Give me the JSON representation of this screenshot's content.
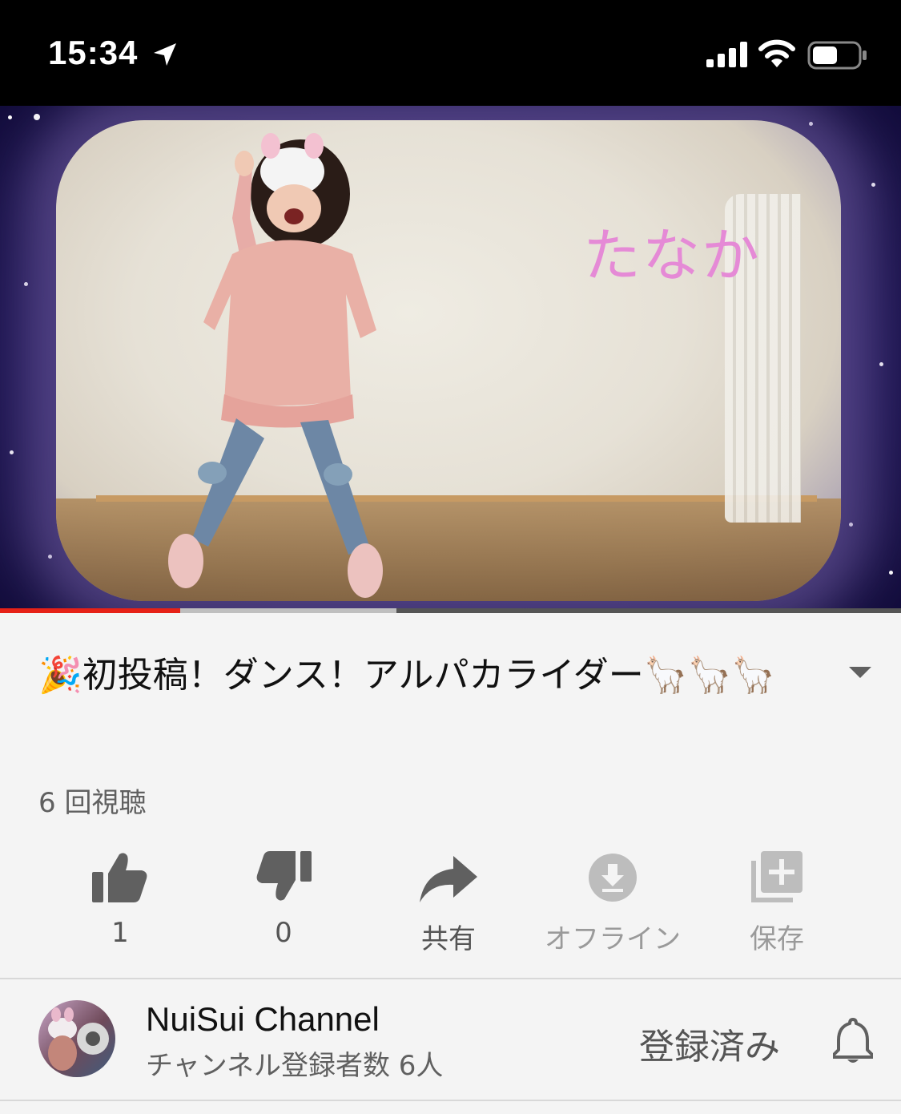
{
  "status_bar": {
    "time": "15:34",
    "icons": [
      "location-arrow-icon",
      "signal-icon",
      "wifi-icon",
      "battery-icon"
    ]
  },
  "video": {
    "overlay_text": "たなか",
    "progress_played": 0.2,
    "progress_buffered": 0.44,
    "colors": {
      "played": "#e62117",
      "buffered": "#bfbfbf",
      "track": "#555555"
    }
  },
  "info": {
    "title": "🎉初投稿！ダンス！アルパカライダー🦙🦙🦙",
    "views": "6 回視聴"
  },
  "actions": [
    {
      "name": "like",
      "icon": "thumbs-up-icon",
      "label": "1"
    },
    {
      "name": "dislike",
      "icon": "thumbs-down-icon",
      "label": "0"
    },
    {
      "name": "share",
      "icon": "share-icon",
      "label": "共有"
    },
    {
      "name": "offline",
      "icon": "download-icon",
      "label": "オフライン"
    },
    {
      "name": "save",
      "icon": "add-to-playlist-icon",
      "label": "保存"
    }
  ],
  "channel": {
    "name": "NuiSui Channel",
    "subscribers": "チャンネル登録者数 6人",
    "subscribe_status": "登録済み"
  }
}
